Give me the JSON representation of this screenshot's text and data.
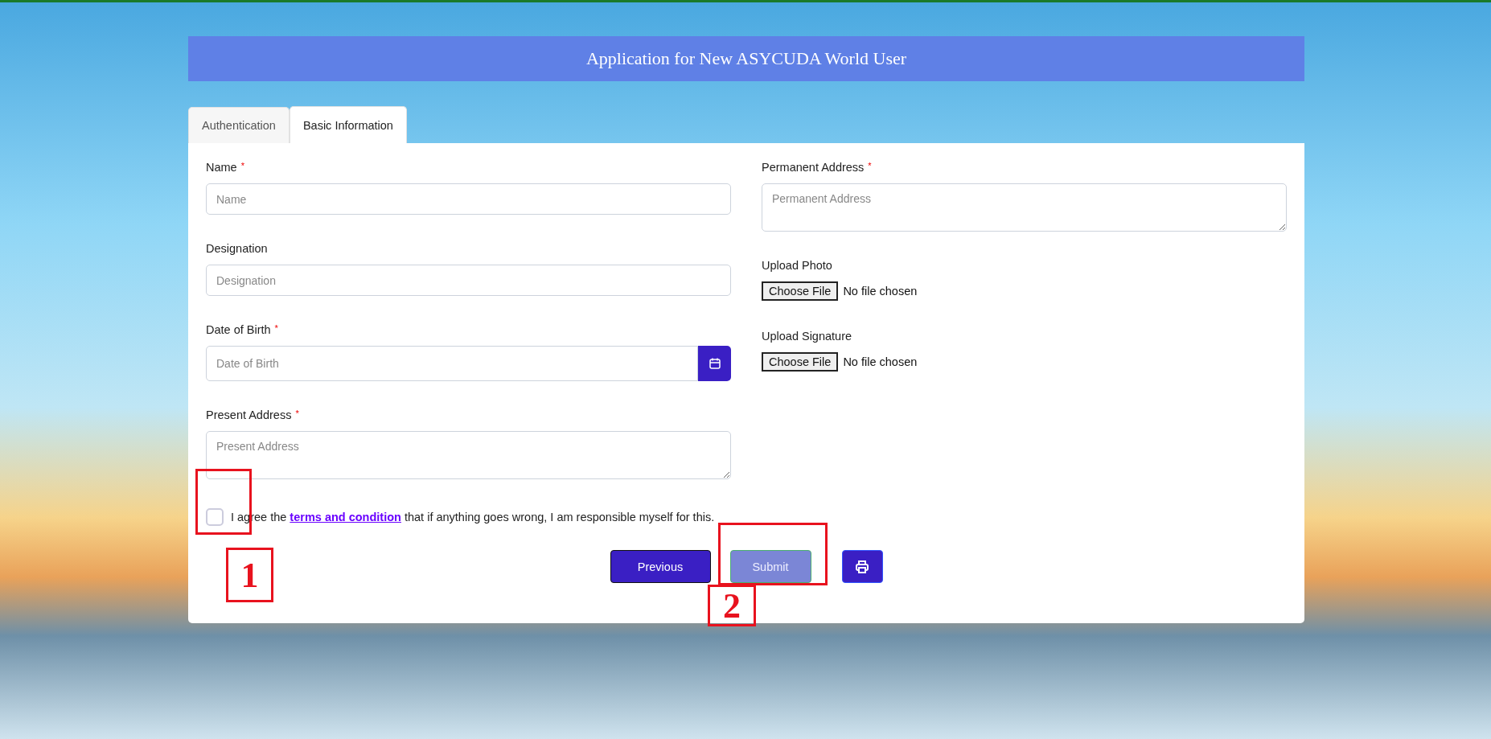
{
  "header": {
    "title": "Application for New ASYCUDA World User"
  },
  "tabs": [
    {
      "label": "Authentication",
      "selected": false
    },
    {
      "label": "Basic Information",
      "selected": true
    }
  ],
  "left_fields": [
    {
      "kind": "text",
      "label": "Name",
      "required_mark": "*",
      "placeholder": "Name"
    },
    {
      "kind": "text",
      "label": "Designation",
      "placeholder": "Designation"
    },
    {
      "kind": "date",
      "label": "Date of Birth",
      "required_mark": "*",
      "placeholder": "Date of Birth"
    },
    {
      "kind": "textarea",
      "label": "Present Address",
      "required_mark": "*",
      "placeholder": "Present Address"
    }
  ],
  "right_fields": [
    {
      "kind": "textarea",
      "label": "Permanent Address",
      "required_mark": "*",
      "placeholder": "Permanent Address"
    },
    {
      "kind": "file",
      "label": "Upload Photo",
      "button": "Choose File",
      "status": "No file chosen"
    },
    {
      "kind": "file",
      "label": "Upload Signature",
      "button": "Choose File",
      "status": "No file chosen"
    }
  ],
  "agreement": {
    "checked": false,
    "before": "I agree the ",
    "link": "terms and condition",
    "after": " that if anything goes wrong, I am responsible myself for this."
  },
  "buttons": {
    "previous": "Previous",
    "submit": "Submit",
    "submit_disabled": true
  },
  "annotations": [
    {
      "number": "1"
    },
    {
      "number": "2"
    }
  ]
}
